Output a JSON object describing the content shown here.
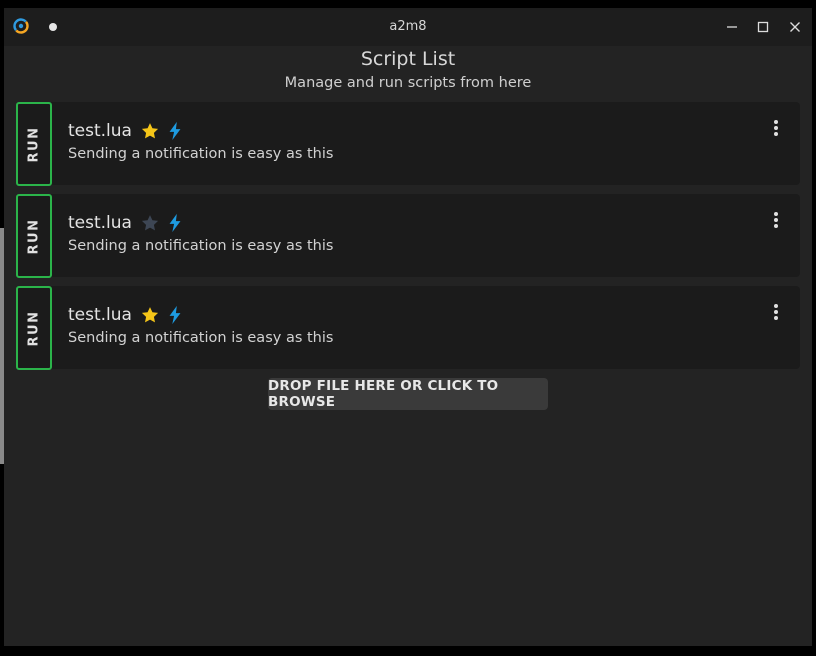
{
  "window": {
    "title": "a2m8",
    "logo_icon": "a2m8-logo-icon",
    "controls": [
      "minimize-icon",
      "maximize-icon",
      "close-icon"
    ]
  },
  "header": {
    "title": "Script List",
    "subtitle": "Manage and run scripts from here"
  },
  "scripts": [
    {
      "run_label": "RUN",
      "name": "test.lua",
      "description": "Sending a notification is easy as this",
      "favorite": true
    },
    {
      "run_label": "RUN",
      "name": "test.lua",
      "description": "Sending a notification is easy as this",
      "favorite": false
    },
    {
      "run_label": "RUN",
      "name": "test.lua",
      "description": "Sending a notification is easy as this",
      "favorite": true
    }
  ],
  "drop_zone": {
    "label": "DROP FILE HERE OR CLICK TO BROWSE"
  },
  "colors": {
    "run_border": "#2bb44a",
    "star_active": "#f5c518",
    "star_inactive": "#3d4654",
    "bolt": "#1e9be0",
    "card_bg": "#1b1b1b",
    "window_bg": "#232323"
  }
}
